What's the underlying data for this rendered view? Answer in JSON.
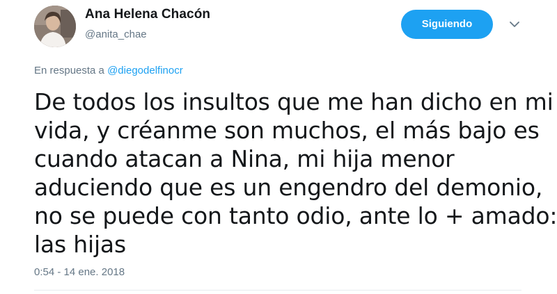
{
  "author": {
    "name": "Ana Helena Chacón",
    "handle": "@anita_chae"
  },
  "follow_button": {
    "label": "Siguiendo",
    "color": "#1da1f2"
  },
  "menu": {
    "icon": "chevron-down-icon"
  },
  "reply_context": {
    "prefix": "En respuesta a",
    "mention": "@diegodelfinocr"
  },
  "tweet": {
    "lines": [
      "De todos los insultos que me han dicho en mi",
      "vida, y créanme son muchos, el más bajo es",
      "cuando atacan a Nina, mi hija menor",
      "aduciendo que es un engendro del demonio,",
      "no se puede con tanto odio, ante lo + amado:",
      "las hijas"
    ],
    "timestamp": "0:54 - 14 ene. 2018"
  }
}
